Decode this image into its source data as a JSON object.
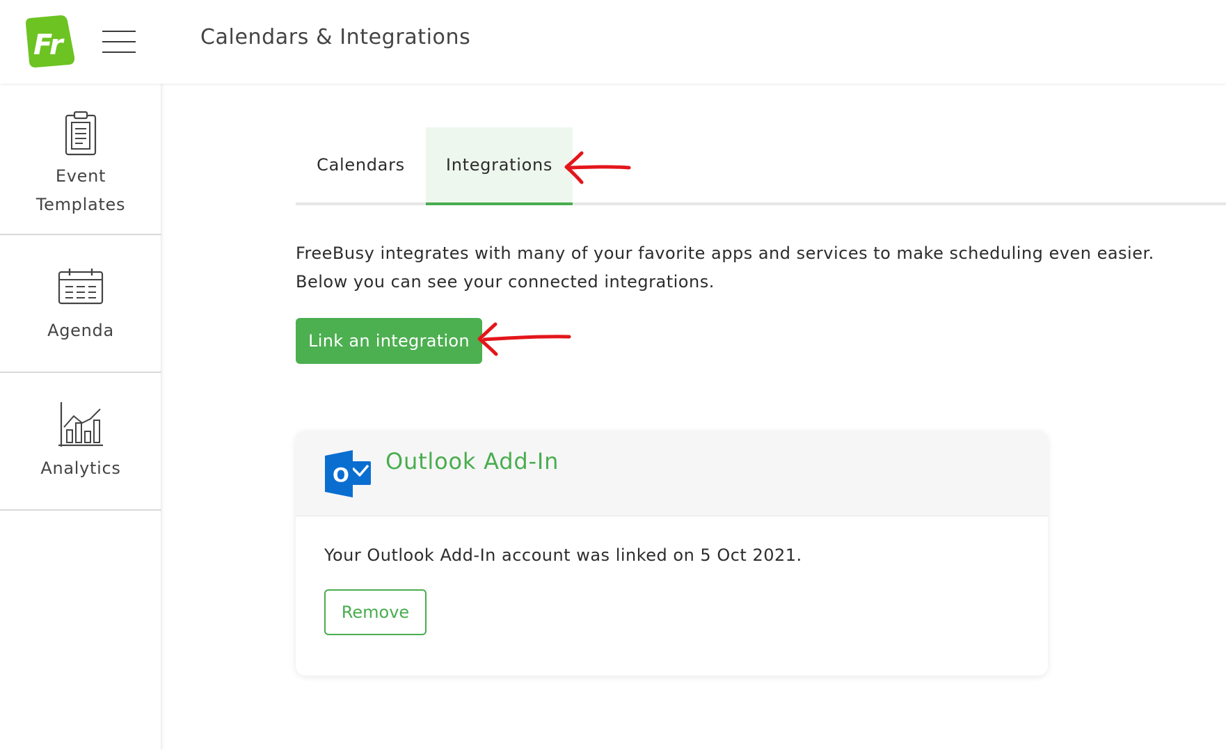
{
  "header": {
    "logo_text": "Fr",
    "menu_icon": "hamburger-icon",
    "title": "Calendars & Integrations"
  },
  "sidebar": {
    "items": [
      {
        "label_line1": "Event",
        "label_line2": "Templates",
        "icon": "clipboard-icon"
      },
      {
        "label": "Agenda",
        "icon": "calendar-icon"
      },
      {
        "label": "Analytics",
        "icon": "analytics-chart-icon"
      }
    ]
  },
  "tabs": [
    {
      "label": "Calendars",
      "active": false
    },
    {
      "label": "Integrations",
      "active": true
    }
  ],
  "intro": {
    "line1": "FreeBusy integrates with many of your favorite apps and services to make scheduling even easier.",
    "line2": "Below you can see your connected integrations."
  },
  "link_button": {
    "label": "Link an integration"
  },
  "integration_card": {
    "icon": "outlook-icon",
    "icon_letter": "O",
    "title": "Outlook Add-In",
    "status_text": "Your Outlook Add-In account was linked on 5 Oct 2021.",
    "remove_label": "Remove"
  },
  "colors": {
    "brand_green": "#4caf50",
    "logo_green": "#6cc321",
    "active_tab_bg": "#eef7ee",
    "outlook_blue": "#0a6ed1",
    "annotation_red": "#e3161b"
  }
}
